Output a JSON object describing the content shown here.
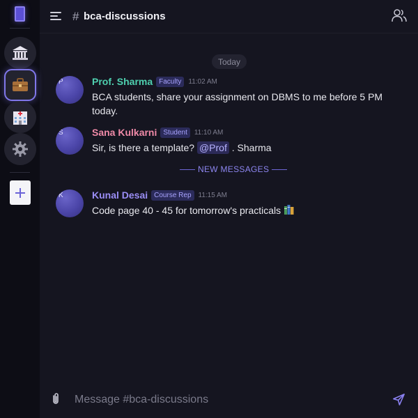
{
  "channel": {
    "hash": "#",
    "name": "bca-discussions"
  },
  "rail": {
    "items": [
      {
        "icon": "bank-icon"
      },
      {
        "icon": "briefcase-icon",
        "active": true
      },
      {
        "icon": "hospital-icon"
      },
      {
        "icon": "gear-icon"
      }
    ],
    "add_label": "+"
  },
  "feed": {
    "date_label": "Today",
    "new_messages_label": "NEW MESSAGES",
    "messages": [
      {
        "avatar_initial": "P",
        "author": "Prof. Sharma",
        "author_color": "#4fd1b0",
        "role": "Faculty",
        "time": "11:02 AM",
        "text": "BCA students, share your assignment on DBMS to me before 5 PM today."
      },
      {
        "avatar_initial": "S",
        "author": "Sana Kulkarni",
        "author_color": "#f08aa8",
        "role": "Student",
        "time": "11:10 AM",
        "text_before": "Sir, is there a template? ",
        "mention": "@Prof",
        "text_after": " . Sharma"
      },
      {
        "avatar_initial": "K",
        "author": "Kunal Desai",
        "author_color": "#9b8ef5",
        "role": "Course Rep",
        "time": "11:15 AM",
        "text": "Code page 40 - 45 for tomorrow's practicals",
        "emoji_icon": "books-icon"
      }
    ]
  },
  "composer": {
    "placeholder": "Message #bca-discussions"
  },
  "colors": {
    "accent": "#8077ea",
    "background": "#151520",
    "rail_background": "#0d0d15"
  }
}
